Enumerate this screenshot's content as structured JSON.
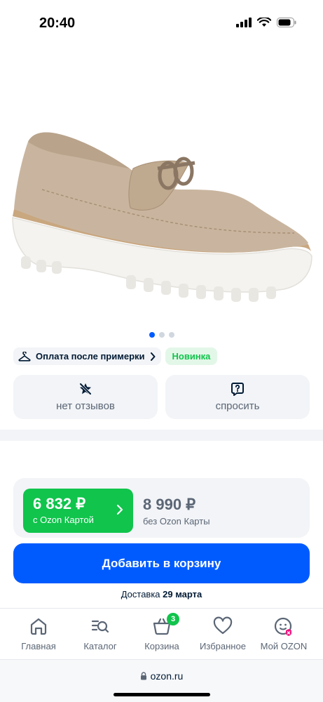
{
  "status_bar": {
    "time": "20:40"
  },
  "product": {
    "image_alt": "beige-suede-loafer",
    "carousel_count": 3,
    "carousel_active": 0
  },
  "badges": {
    "payment_after_fitting": "Оплата после примерки",
    "new": "Новинка"
  },
  "actions": {
    "reviews_label": "нет отзывов",
    "ask_label": "спросить"
  },
  "price": {
    "ozon_card_price": "6 832 ₽",
    "ozon_card_label": "с Ozon Картой",
    "regular_price": "8 990 ₽",
    "regular_label": "без Ozon Карты"
  },
  "cart": {
    "add_button": "Добавить в корзину"
  },
  "delivery": {
    "prefix": "Доставка",
    "date": "29 марта"
  },
  "tabbar": {
    "items": [
      {
        "label": "Главная",
        "icon": "home-icon"
      },
      {
        "label": "Каталог",
        "icon": "catalog-search-icon"
      },
      {
        "label": "Корзина",
        "icon": "basket-icon",
        "badge": "3"
      },
      {
        "label": "Избранное",
        "icon": "heart-icon"
      },
      {
        "label": "Мой OZON",
        "icon": "profile-face-icon"
      }
    ]
  },
  "browser": {
    "url": "ozon.ru"
  },
  "colors": {
    "primary_blue": "#005bff",
    "ozon_green": "#10c44c",
    "text_dark": "#001a34",
    "text_muted": "#5b6675"
  }
}
